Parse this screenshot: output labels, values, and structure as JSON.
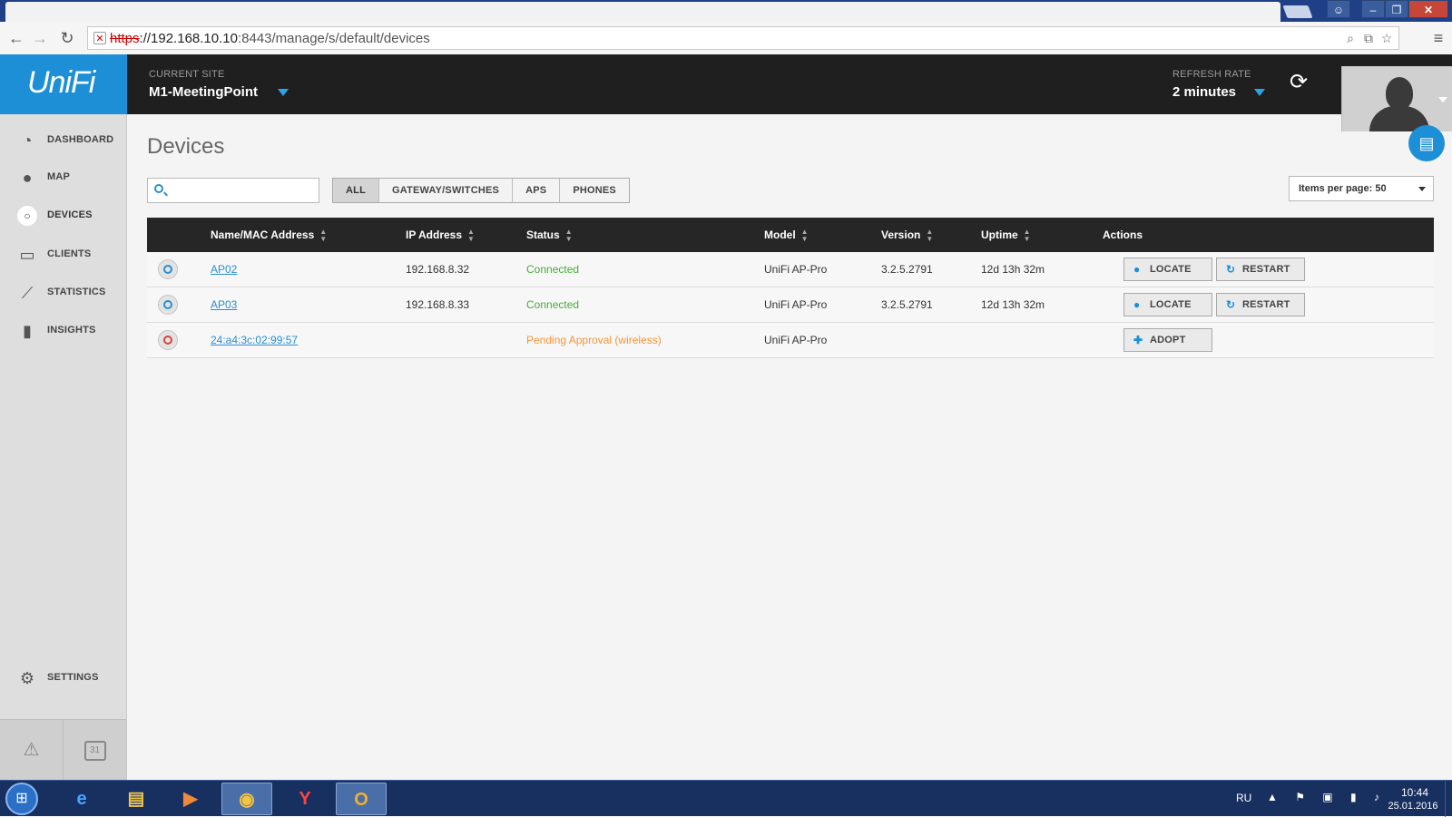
{
  "browser": {
    "url_scheme": "https",
    "url_host": "://192.168.10.10",
    "url_rest": ":8443/manage/s/default/devices"
  },
  "header": {
    "logo": "UniFi",
    "current_site_label": "CURRENT SITE",
    "current_site": "M1-MeetingPoint",
    "refresh_rate_label": "REFRESH RATE",
    "refresh_rate": "2 minutes",
    "accent_color": "#1c8fd6"
  },
  "sidebar": {
    "items": [
      {
        "label": "DASHBOARD",
        "icon": "dashboard-icon"
      },
      {
        "label": "MAP",
        "icon": "map-pin-icon"
      },
      {
        "label": "DEVICES",
        "icon": "devices-icon"
      },
      {
        "label": "CLIENTS",
        "icon": "laptop-icon"
      },
      {
        "label": "STATISTICS",
        "icon": "line-chart-icon"
      },
      {
        "label": "INSIGHTS",
        "icon": "bar-chart-icon"
      },
      {
        "label": "SETTINGS",
        "icon": "gear-icon"
      }
    ],
    "calendar_day": "31"
  },
  "main": {
    "title": "Devices",
    "search_placeholder": "",
    "filters": [
      "ALL",
      "GATEWAY/SWITCHES",
      "APS",
      "PHONES"
    ],
    "active_filter": "ALL",
    "items_per_page": "Items per page: 50"
  },
  "table": {
    "columns": [
      "Name/MAC Address",
      "IP Address",
      "Status",
      "Model",
      "Version",
      "Uptime",
      "Actions"
    ],
    "rows": [
      {
        "name": "AP02",
        "ip": "192.168.8.32",
        "status": "Connected",
        "model": "UniFi AP-Pro",
        "version": "3.2.5.2791",
        "uptime": "12d 13h 32m"
      },
      {
        "name": "AP03",
        "ip": "192.168.8.33",
        "status": "Connected",
        "model": "UniFi AP-Pro",
        "version": "3.2.5.2791",
        "uptime": "12d 13h 32m"
      },
      {
        "name": "24:a4:3c:02:99:57",
        "ip": "",
        "status": "Pending Approval (wireless)",
        "model": "UniFi AP-Pro",
        "version": "",
        "uptime": ""
      }
    ],
    "actions": {
      "locate": "LOCATE",
      "restart": "RESTART",
      "adopt": "ADOPT"
    },
    "status_colors": {
      "connected": "#4aaa3c",
      "pending": "#f2963a"
    }
  },
  "taskbar": {
    "language": "RU",
    "time": "10:44",
    "date": "25.01.2016"
  }
}
